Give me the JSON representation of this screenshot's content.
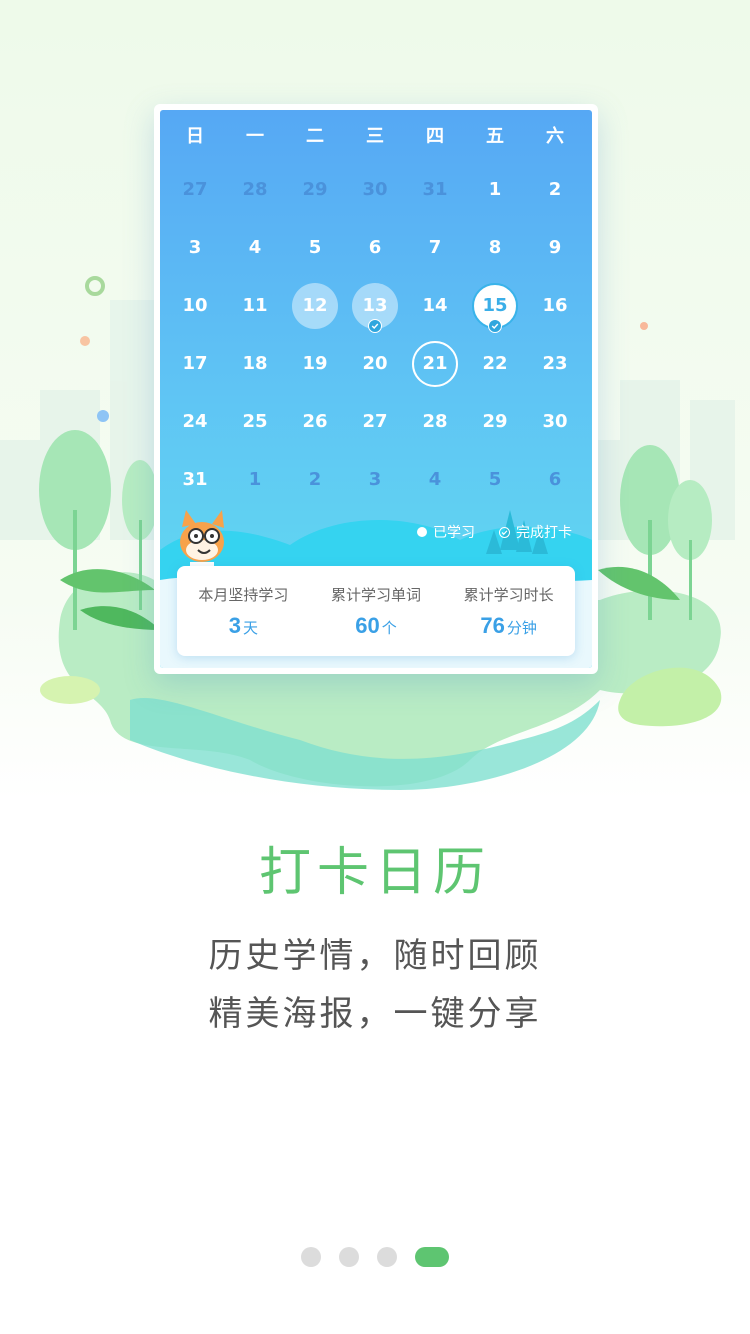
{
  "calendar": {
    "weekdays": [
      "日",
      "一",
      "二",
      "三",
      "四",
      "五",
      "六"
    ],
    "weeks": [
      [
        {
          "d": "27",
          "other": true
        },
        {
          "d": "28",
          "other": true
        },
        {
          "d": "29",
          "other": true
        },
        {
          "d": "30",
          "other": true
        },
        {
          "d": "31",
          "other": true
        },
        {
          "d": "1"
        },
        {
          "d": "2"
        }
      ],
      [
        {
          "d": "3"
        },
        {
          "d": "4"
        },
        {
          "d": "5"
        },
        {
          "d": "6"
        },
        {
          "d": "7"
        },
        {
          "d": "8"
        },
        {
          "d": "9"
        }
      ],
      [
        {
          "d": "10"
        },
        {
          "d": "11"
        },
        {
          "d": "12",
          "state": "studied"
        },
        {
          "d": "13",
          "state": "studied",
          "check": true
        },
        {
          "d": "14"
        },
        {
          "d": "15",
          "state": "today",
          "check": true
        },
        {
          "d": "16"
        }
      ],
      [
        {
          "d": "17"
        },
        {
          "d": "18"
        },
        {
          "d": "19"
        },
        {
          "d": "20"
        },
        {
          "d": "21",
          "state": "ring"
        },
        {
          "d": "22"
        },
        {
          "d": "23"
        }
      ],
      [
        {
          "d": "24"
        },
        {
          "d": "25"
        },
        {
          "d": "26"
        },
        {
          "d": "27"
        },
        {
          "d": "28"
        },
        {
          "d": "29"
        },
        {
          "d": "30"
        }
      ],
      [
        {
          "d": "31"
        },
        {
          "d": "1",
          "other": true
        },
        {
          "d": "2",
          "other": true
        },
        {
          "d": "3",
          "other": true
        },
        {
          "d": "4",
          "other": true
        },
        {
          "d": "5",
          "other": true
        },
        {
          "d": "6",
          "other": true
        }
      ]
    ],
    "legend": {
      "studied_label": "已学习",
      "checked_label": "完成打卡"
    }
  },
  "stats": {
    "month_streak": {
      "label": "本月坚持学习",
      "value": "3",
      "unit": "天"
    },
    "total_words": {
      "label": "累计学习单词",
      "value": "60",
      "unit": "个"
    },
    "total_time": {
      "label": "累计学习时长",
      "value": "76",
      "unit": "分钟"
    }
  },
  "title": "打卡日历",
  "subtitle_line1": "历史学情，随时回顾",
  "subtitle_line2": "精美海报，一键分享",
  "pager": {
    "count": 4,
    "active": 4
  },
  "colors": {
    "accent_green": "#5ec571",
    "calendar_blue_top": "#56a8f4",
    "calendar_blue_bottom": "#62def0",
    "stat_value_blue": "#3aa0e6"
  }
}
